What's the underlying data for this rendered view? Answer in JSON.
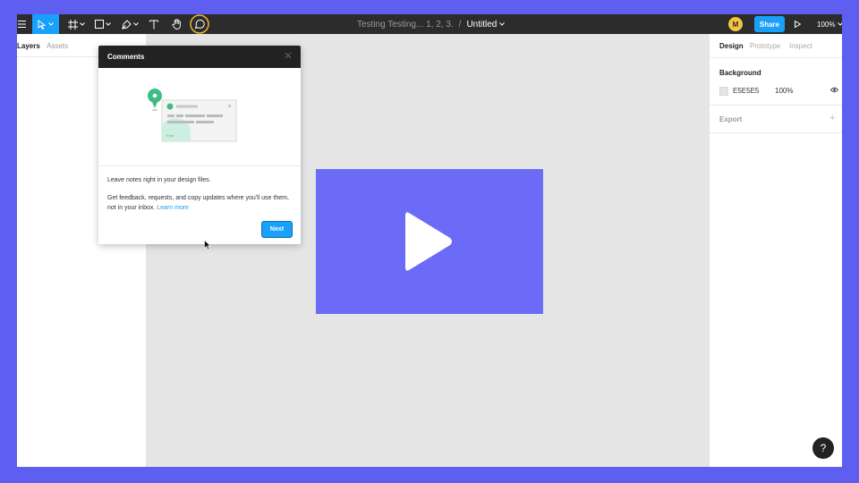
{
  "toolbar": {
    "project_name": "Testing Testing... 1, 2, 3.",
    "separator": "/",
    "file_name": "Untitled",
    "avatar_initial": "M",
    "share_label": "Share",
    "zoom": "100%",
    "tools": [
      "menu-icon",
      "move-icon",
      "frame-icon",
      "shape-icon",
      "pen-icon",
      "text-icon",
      "hand-icon",
      "comment-icon"
    ]
  },
  "left_panel": {
    "tabs": [
      {
        "label": "Layers",
        "active": true
      },
      {
        "label": "Assets",
        "active": false
      }
    ]
  },
  "right_panel": {
    "tabs": [
      {
        "label": "Design",
        "active": true
      },
      {
        "label": "Prototype",
        "active": false
      },
      {
        "label": "Inspect",
        "active": false
      }
    ],
    "background": {
      "title": "Background",
      "hex": "E5E5E5",
      "opacity": "100%",
      "color": "#e5e5e5"
    },
    "export_title": "Export"
  },
  "comments_popover": {
    "title": "Comments",
    "text_line1": "Leave notes right in your design files.",
    "text_line2": "Get feedback, requests, and copy updates where you'll use them, not in your inbox.",
    "learn_more": "Learn more",
    "next_label": "Next",
    "illustration_post": "Post"
  },
  "help_label": "?",
  "colors": {
    "page_bg": "#5e5ef0",
    "toolbar_bg": "#2c2c2c",
    "accent": "#18a0fb",
    "canvas_bg": "#e5e5e5",
    "frame_fill": "#6b6bf8"
  }
}
